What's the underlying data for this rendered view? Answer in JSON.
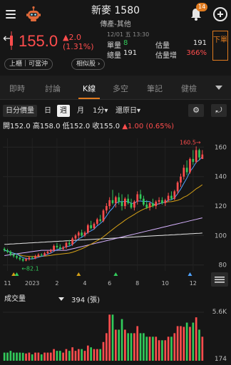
{
  "header": {
    "stock_name": "新麥 1580",
    "stock_category": "傳產-其他",
    "notification_count": "14"
  },
  "quote": {
    "price": "155.0",
    "change": "▲2.0",
    "change_pct": "(1.31%)",
    "time": "12/01 五 13:30",
    "single_vol_label": "單量",
    "single_vol": "8",
    "est_vol_label": "估量",
    "est_vol": "191",
    "total_vol_label": "總量",
    "total_vol": "191",
    "est_vol_inc_label": "估量增",
    "est_vol_inc": "366%",
    "trade_button": "下單",
    "tag_listing": "上櫃｜可當沖",
    "tag_similar": "相似股",
    "up_color": "#ff4d4d",
    "down_color": "#32c95a",
    "accent_color": "#e07b1f"
  },
  "tabs": [
    {
      "label": "即時"
    },
    {
      "label": "討論"
    },
    {
      "label": "K線"
    },
    {
      "label": "多空"
    },
    {
      "label": "筆記"
    },
    {
      "label": "健檢"
    }
  ],
  "active_tab": "K線",
  "toolbar": {
    "kline_type": "日分價量",
    "period_day": "日",
    "period_week": "週",
    "period_month": "月",
    "minute": "1分▾",
    "adjust": "還原日▾",
    "selected": "週"
  },
  "ohlc": {
    "open": "開152.0",
    "high": "高158.0",
    "low": "低152.0",
    "close": "收155.0",
    "change": "▲1.00 (0.65%)"
  },
  "chart_data": {
    "type": "candlestick",
    "y_ticks": [
      "160",
      "140",
      "120",
      "100",
      "80"
    ],
    "ylim": [
      76,
      166
    ],
    "x_ticks": [
      "11",
      "2023",
      "2",
      "4",
      "6",
      "8",
      "10",
      "12"
    ],
    "annotation_high": "160.5",
    "annotation_low": "82.1",
    "candles": [
      [
        91,
        92,
        89,
        90
      ],
      [
        90,
        91,
        88,
        89
      ],
      [
        89,
        90,
        86,
        87
      ],
      [
        87,
        88,
        85,
        86
      ],
      [
        86,
        87,
        84,
        85
      ],
      [
        85,
        86,
        83,
        84
      ],
      [
        84,
        85,
        82.1,
        83
      ],
      [
        83,
        85,
        82.5,
        84
      ],
      [
        84,
        86,
        83,
        85
      ],
      [
        85,
        86,
        84,
        84.5
      ],
      [
        84.5,
        87,
        84,
        86
      ],
      [
        86,
        88,
        85,
        87
      ],
      [
        87,
        88,
        86,
        86.5
      ],
      [
        86.5,
        89,
        86,
        88
      ],
      [
        88,
        90,
        87,
        89
      ],
      [
        89,
        91,
        88,
        90
      ],
      [
        90,
        94,
        89,
        93
      ],
      [
        93,
        95,
        91,
        92
      ],
      [
        92,
        94,
        90,
        91
      ],
      [
        91,
        93,
        90,
        92
      ],
      [
        92,
        96,
        91,
        95
      ],
      [
        95,
        97,
        93,
        94
      ],
      [
        94,
        99,
        93,
        98
      ],
      [
        98,
        101,
        97,
        100
      ],
      [
        100,
        103,
        98,
        102
      ],
      [
        102,
        104,
        99,
        100
      ],
      [
        100,
        103,
        99,
        102
      ],
      [
        102,
        108,
        101,
        107
      ],
      [
        107,
        110,
        104,
        105
      ],
      [
        105,
        109,
        104,
        108
      ],
      [
        108,
        112,
        107,
        111
      ],
      [
        111,
        114,
        109,
        110
      ],
      [
        110,
        118,
        109,
        117
      ],
      [
        117,
        122,
        115,
        120
      ],
      [
        120,
        126,
        118,
        124
      ],
      [
        124,
        131,
        121,
        122
      ],
      [
        122,
        127,
        119,
        126
      ],
      [
        126,
        129,
        121,
        123
      ],
      [
        123,
        128,
        117,
        120
      ],
      [
        120,
        126,
        118,
        125
      ],
      [
        125,
        128,
        121,
        122
      ],
      [
        122,
        125,
        118,
        119
      ],
      [
        119,
        124,
        117,
        123
      ],
      [
        123,
        130,
        121,
        128
      ],
      [
        128,
        131,
        124,
        125
      ],
      [
        125,
        127,
        120,
        121
      ],
      [
        121,
        124,
        118,
        119
      ],
      [
        119,
        123,
        117,
        122
      ],
      [
        122,
        125,
        119,
        120
      ],
      [
        120,
        124,
        118,
        123
      ],
      [
        123,
        126,
        121,
        124
      ],
      [
        124,
        126,
        121,
        122
      ],
      [
        122,
        125,
        120,
        124
      ],
      [
        124,
        129,
        123,
        127
      ],
      [
        127,
        130,
        124,
        125
      ],
      [
        125,
        131,
        124,
        130
      ],
      [
        130,
        137,
        128,
        136
      ],
      [
        136,
        142,
        133,
        140
      ],
      [
        140,
        148,
        138,
        146
      ],
      [
        146,
        151,
        141,
        143
      ],
      [
        143,
        153,
        142,
        152
      ],
      [
        152,
        158,
        148,
        150
      ],
      [
        150,
        160.5,
        149,
        158
      ],
      [
        158,
        159,
        151,
        153
      ],
      [
        152,
        158,
        152,
        155
      ]
    ],
    "ma_fast_color": "#4fa3ff",
    "ma_mid_color": "#d4a017",
    "ma_slow_color": "#d7b3ff",
    "ma_long_color": "#e6e6e6"
  },
  "volume": {
    "label": "成交量",
    "value": "394 (張)",
    "max_tick": "5.6K",
    "min_tick": "174"
  }
}
